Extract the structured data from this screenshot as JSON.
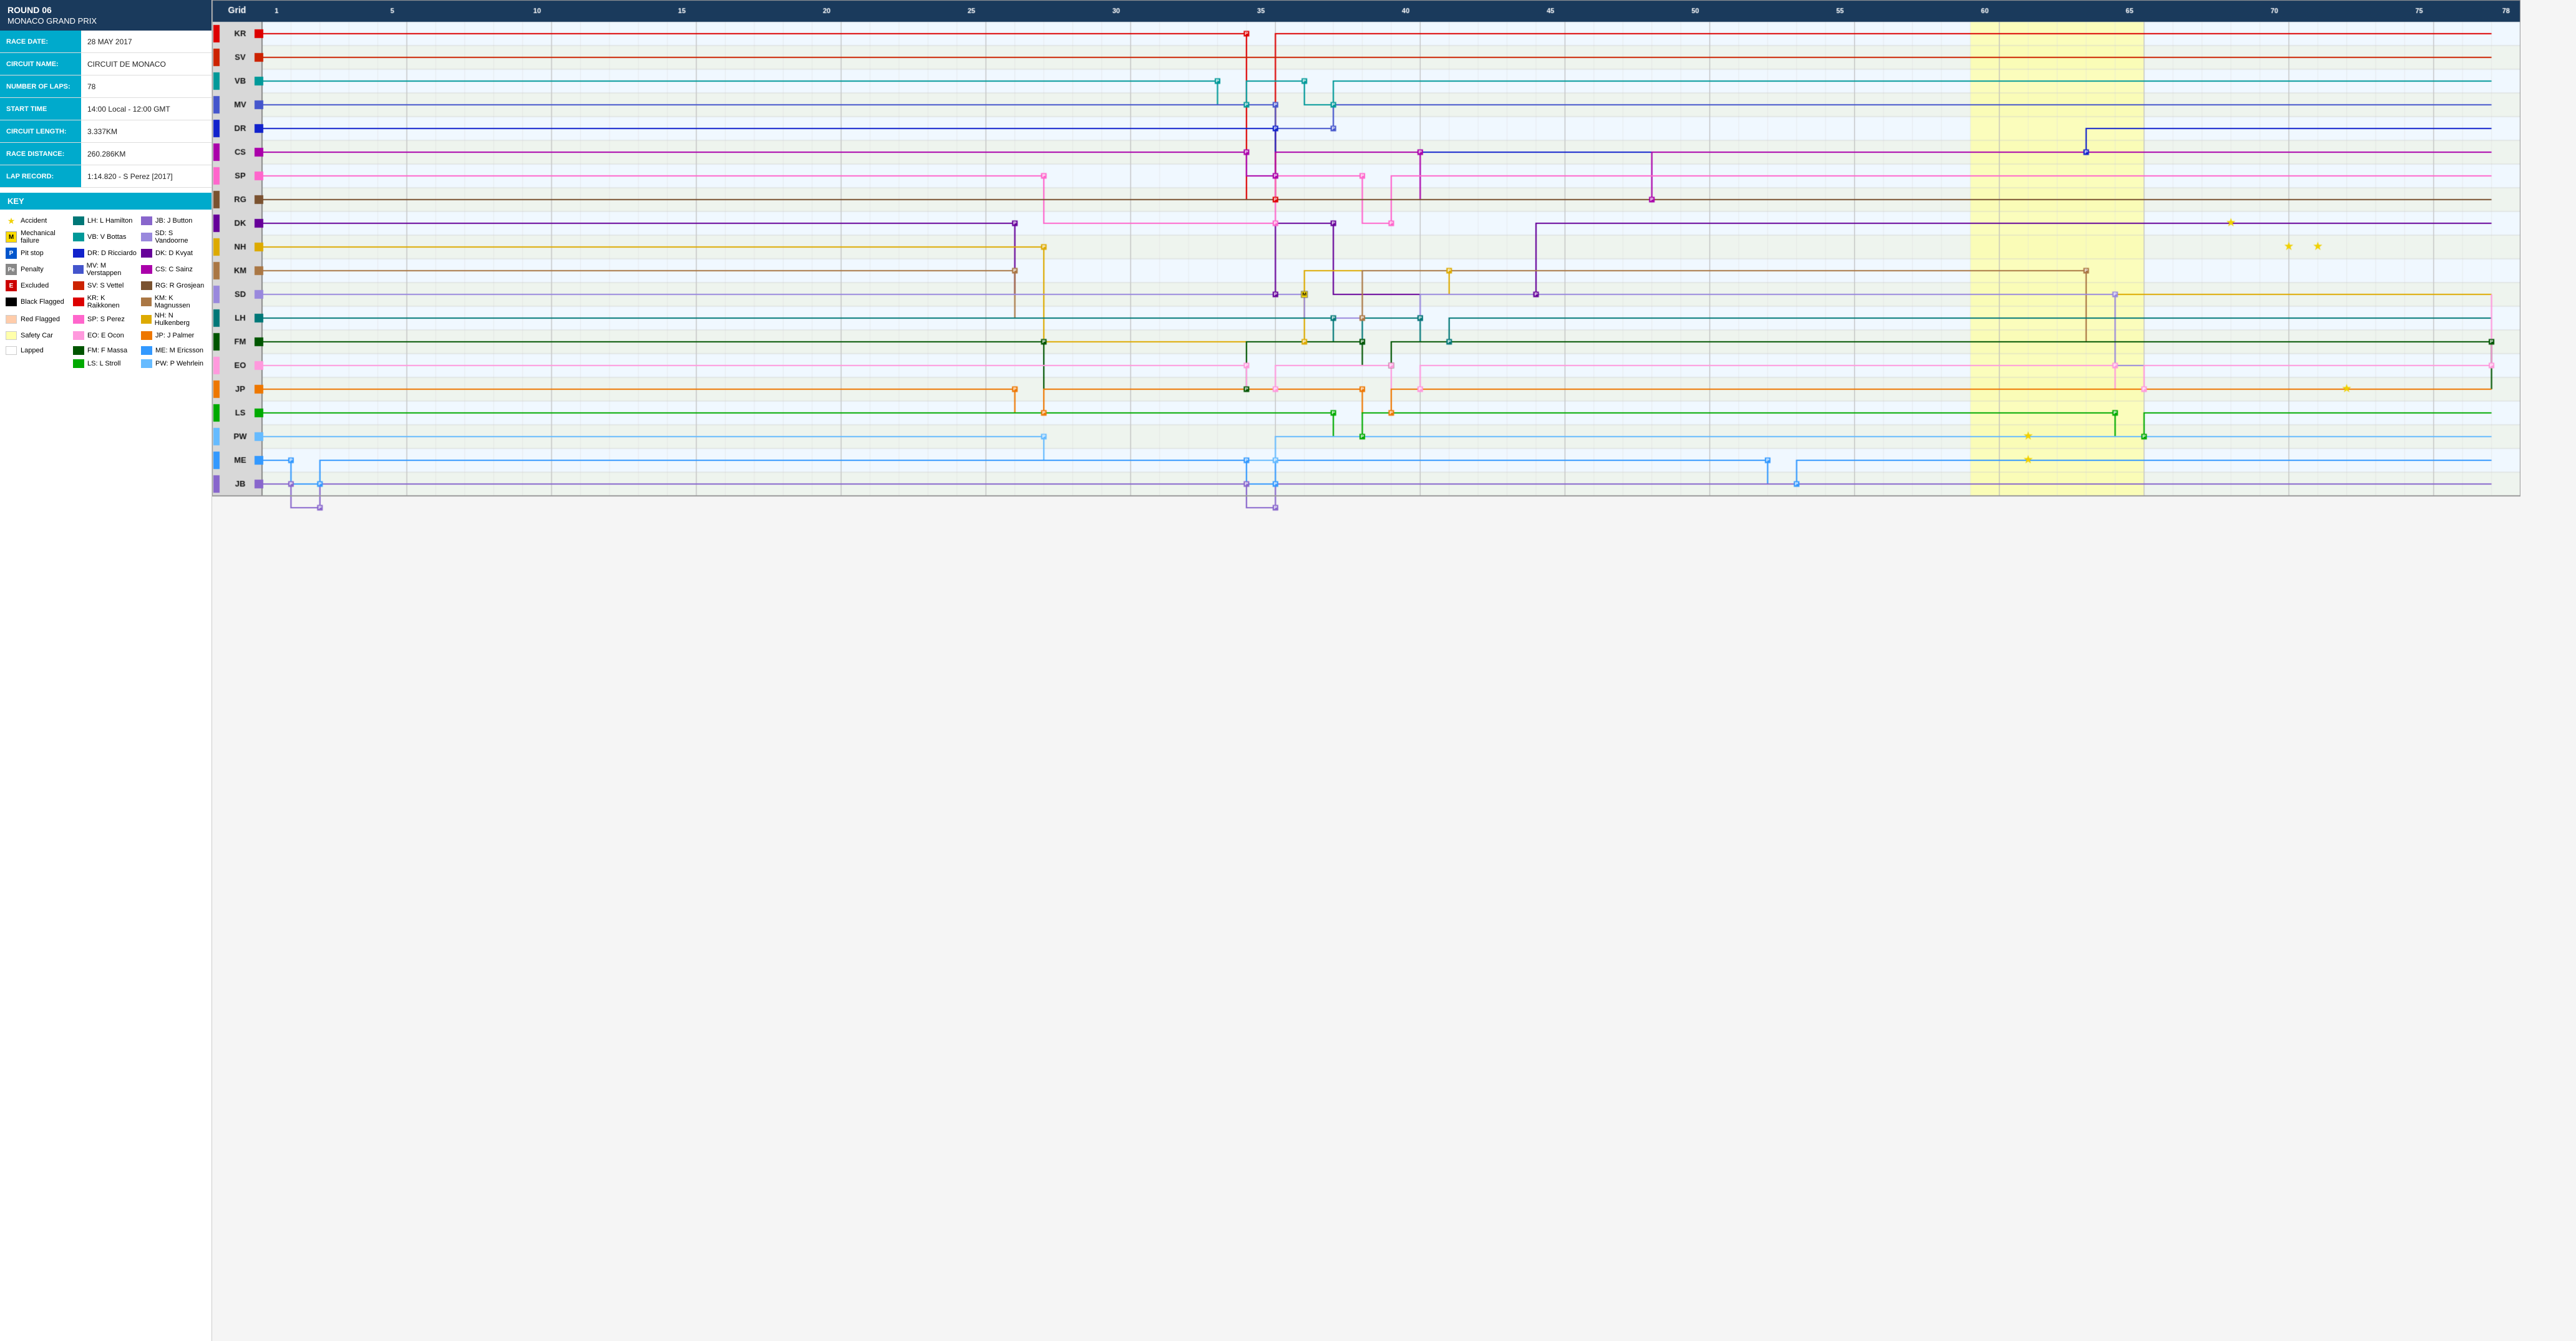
{
  "leftPanel": {
    "roundHeader": {
      "roundNum": "ROUND 06",
      "raceName": "MONACO GRAND PRIX"
    },
    "infoRows": [
      {
        "label": "RACE DATE:",
        "value": "28 MAY 2017"
      },
      {
        "label": "CIRCUIT NAME:",
        "value": "CIRCUIT DE MONACO"
      },
      {
        "label": "NUMBER OF LAPS:",
        "value": "78"
      },
      {
        "label": "START TIME",
        "value": "14:00 Local - 12:00 GMT"
      },
      {
        "label": "CIRCUIT LENGTH:",
        "value": "3.337KM"
      },
      {
        "label": "RACE DISTANCE:",
        "value": "260.286KM"
      },
      {
        "label": "LAP RECORD:",
        "value": "1:14.820 - S Perez [2017]"
      }
    ],
    "keyTitle": "KEY",
    "keySymbols": [
      {
        "symbol": "star",
        "label": "Accident"
      },
      {
        "symbol": "M",
        "label": "Mechanical failure"
      },
      {
        "symbol": "P",
        "label": "Pit stop"
      },
      {
        "symbol": "Pe",
        "label": "Penalty"
      },
      {
        "symbol": "E",
        "label": "Excluded"
      },
      {
        "symbol": "bf",
        "label": "Black Flagged"
      },
      {
        "symbol": "rf",
        "label": "Red Flagged"
      },
      {
        "symbol": "sc",
        "label": "Safety Car"
      },
      {
        "symbol": "lp",
        "label": "Lapped"
      }
    ],
    "drivers": [
      {
        "code": "LH",
        "name": "L Hamilton",
        "color": "#007777"
      },
      {
        "code": "VB",
        "name": "V Bottas",
        "color": "#009999"
      },
      {
        "code": "DR",
        "name": "D Ricciardo",
        "color": "#1122cc"
      },
      {
        "code": "MV",
        "name": "M Verstappen",
        "color": "#4455cc"
      },
      {
        "code": "SV",
        "name": "S Vettel",
        "color": "#cc0000"
      },
      {
        "code": "KR",
        "name": "K Raikkonen",
        "color": "#cc0000"
      },
      {
        "code": "SP",
        "name": "S Perez",
        "color": "#ff66cc"
      },
      {
        "code": "EO",
        "name": "E Ocon",
        "color": "#ff99dd"
      },
      {
        "code": "FM",
        "name": "F Massa",
        "color": "#005500"
      },
      {
        "code": "LS",
        "name": "L Stroll",
        "color": "#00aa00"
      },
      {
        "code": "JB",
        "name": "J Button",
        "color": "#8866cc"
      },
      {
        "code": "SD",
        "name": "S Vandoorne",
        "color": "#9988dd"
      },
      {
        "code": "DK",
        "name": "D Kvyat",
        "color": "#660099"
      },
      {
        "code": "CS",
        "name": "C Sainz",
        "color": "#aa00aa"
      },
      {
        "code": "RG",
        "name": "R Grosjean",
        "color": "#7a5230"
      },
      {
        "code": "KM",
        "name": "K Magnussen",
        "color": "#aa7744"
      },
      {
        "code": "NH",
        "name": "N Hulkenberg",
        "color": "#ddaa00"
      },
      {
        "code": "JP",
        "name": "J Palmer",
        "color": "#ee7700"
      },
      {
        "code": "ME",
        "name": "M Ericsson",
        "color": "#3399ff"
      },
      {
        "code": "PW",
        "name": "P Wehrlein",
        "color": "#66bbff"
      }
    ],
    "gridHeader": "Grid",
    "lapNumbers": [
      1,
      5,
      10,
      15,
      20,
      25,
      30,
      35,
      40,
      45,
      50,
      55,
      60,
      65,
      70,
      75,
      78
    ]
  }
}
